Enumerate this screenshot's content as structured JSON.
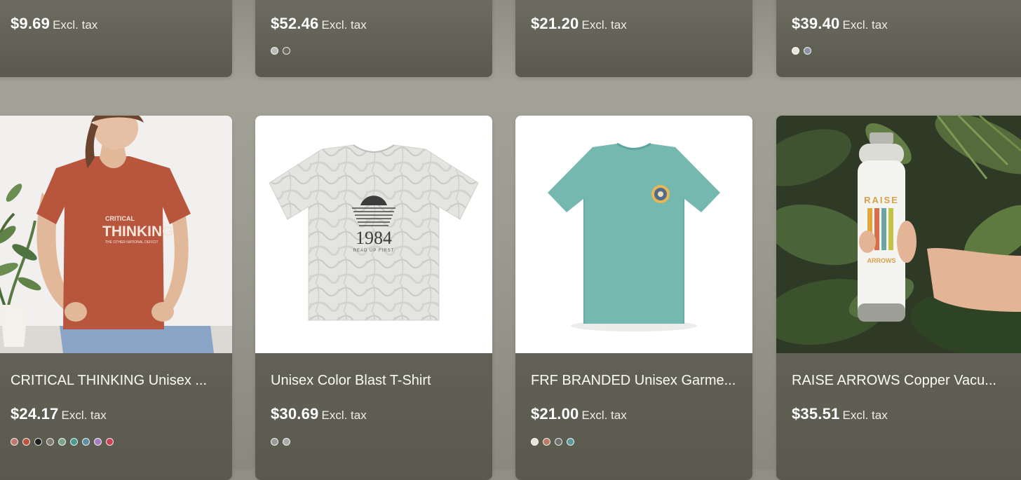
{
  "top_row": [
    {
      "price": "$9.69",
      "tax": "Excl. tax",
      "swatches": []
    },
    {
      "price": "$52.46",
      "tax": "Excl. tax",
      "swatches": [
        "#b9bdb8",
        "#6b6a60"
      ]
    },
    {
      "price": "$21.20",
      "tax": "Excl. tax",
      "swatches": []
    },
    {
      "price": "$39.40",
      "tax": "Excl. tax",
      "swatches": [
        "#e8e6dc",
        "#8c93a3"
      ]
    }
  ],
  "products": [
    {
      "title": "CRITICAL THINKING Unisex ...",
      "price": "$24.17",
      "tax": "Excl. tax",
      "image": "woman-in-rust-tshirt-photo",
      "shirt_text_1": "CRITICAL",
      "shirt_text_2": "THINKING",
      "shirt_text_3": "THE OTHER NATIONAL DEFICIT",
      "swatches": [
        "#c0766c",
        "#b8553f",
        "#1f1f1f",
        "#7d7b72",
        "#7aa38d",
        "#4b9a8f",
        "#5d8fa3",
        "#a57bc0",
        "#c94254"
      ]
    },
    {
      "title": "Unisex Color Blast T-Shirt",
      "price": "$30.69",
      "tax": "Excl. tax",
      "image": "marbled-white-tshirt",
      "shirt_text_1": "1984",
      "shirt_text_2": "READ UP FIRST",
      "swatches": [
        "#9a9a98",
        "#a9aba6"
      ]
    },
    {
      "title": "FRF BRANDED Unisex Garme...",
      "price": "$21.00",
      "tax": "Excl. tax",
      "image": "teal-tshirt-with-badge",
      "swatches": [
        "#e6e3dc",
        "#b87a63",
        "#6c6f6a",
        "#5c9a9a"
      ]
    },
    {
      "title": "RAISE ARROWS Copper Vacu...",
      "price": "$35.51",
      "tax": "Excl. tax",
      "image": "white-bottle-in-hand",
      "bottle_text_1": "RAISE",
      "bottle_text_2": "ARROWS",
      "swatches": []
    }
  ]
}
